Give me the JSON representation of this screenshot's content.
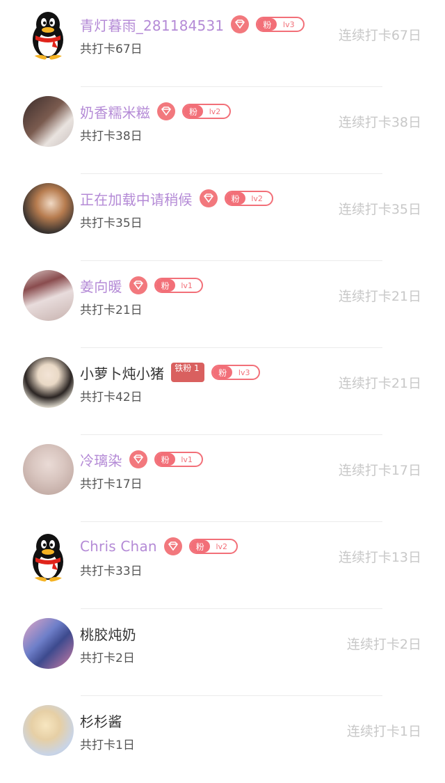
{
  "colors": {
    "name_purple": "#b48ad6",
    "badge_red": "#f26f78",
    "iron_fan_bg": "#d9605f",
    "streak_gray": "#c8c8c8"
  },
  "users": [
    {
      "name": "青灯暮雨_281184531",
      "vip": true,
      "fan_label": "粉",
      "level": "lv3",
      "total": "共打卡67日",
      "streak": "连续打卡67日",
      "avatar": "qq-penguin-icon"
    },
    {
      "name": "奶香糯米糍",
      "vip": true,
      "fan_label": "粉",
      "level": "lv2",
      "total": "共打卡38日",
      "streak": "连续打卡38日",
      "avatar": "photo-avatar"
    },
    {
      "name": "正在加载中请稍候",
      "vip": true,
      "fan_label": "粉",
      "level": "lv2",
      "total": "共打卡35日",
      "streak": "连续打卡35日",
      "avatar": "photo-avatar"
    },
    {
      "name": "姜向暖",
      "vip": true,
      "fan_label": "粉",
      "level": "lv1",
      "total": "共打卡21日",
      "streak": "连续打卡21日",
      "avatar": "photo-avatar"
    },
    {
      "name": "小萝卜炖小猪",
      "vip": false,
      "iron_fan": "铁粉 1",
      "fan_label": "粉",
      "level": "lv3",
      "total": "共打卡42日",
      "streak": "连续打卡21日",
      "avatar": "photo-avatar"
    },
    {
      "name": "冷璃染",
      "vip": true,
      "fan_label": "粉",
      "level": "lv1",
      "total": "共打卡17日",
      "streak": "连续打卡17日",
      "avatar": "photo-avatar"
    },
    {
      "name": "Chris Chan",
      "vip": true,
      "fan_label": "粉",
      "level": "lv2",
      "total": "共打卡33日",
      "streak": "连续打卡13日",
      "avatar": "qq-penguin-icon"
    },
    {
      "name": "桃胶炖奶",
      "vip": false,
      "total": "共打卡2日",
      "streak": "连续打卡2日",
      "avatar": "photo-avatar"
    },
    {
      "name": "杉杉酱",
      "vip": false,
      "total": "共打卡1日",
      "streak": "连续打卡1日",
      "avatar": "photo-avatar"
    }
  ]
}
